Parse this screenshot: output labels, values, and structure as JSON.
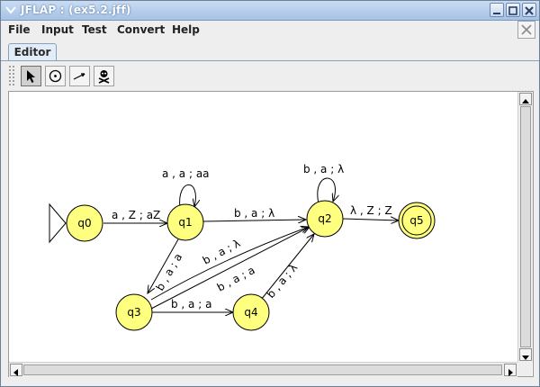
{
  "window": {
    "title": "JFLAP : (ex5.2.jff)"
  },
  "menu": [
    "File",
    "Input",
    "Test",
    "Convert",
    "Help"
  ],
  "tabs": [
    {
      "label": "Editor",
      "active": true
    }
  ],
  "toolbar": {
    "tools": [
      {
        "name": "attribute-editor",
        "icon": "pointer-arrow-icon",
        "selected": true
      },
      {
        "name": "state-creator",
        "icon": "state-circle-icon",
        "selected": false
      },
      {
        "name": "transition-creator",
        "icon": "transition-arrow-icon",
        "selected": false
      },
      {
        "name": "deleter",
        "icon": "skull-crossbones-icon",
        "selected": false
      }
    ]
  },
  "automaton": {
    "states": [
      {
        "id": "q0",
        "label": "q0",
        "initial": true,
        "final": false
      },
      {
        "id": "q1",
        "label": "q1",
        "initial": false,
        "final": false
      },
      {
        "id": "q2",
        "label": "q2",
        "initial": false,
        "final": false
      },
      {
        "id": "q3",
        "label": "q3",
        "initial": false,
        "final": false
      },
      {
        "id": "q4",
        "label": "q4",
        "initial": false,
        "final": false
      },
      {
        "id": "q5",
        "label": "q5",
        "initial": false,
        "final": true
      }
    ],
    "transitions": [
      {
        "from": "q0",
        "to": "q1",
        "label": "a , Z ; aZ"
      },
      {
        "from": "q1",
        "to": "q1",
        "label": "a , a ; aa"
      },
      {
        "from": "q1",
        "to": "q2",
        "label": "b , a ; λ"
      },
      {
        "from": "q2",
        "to": "q2",
        "label": "b , a ; λ"
      },
      {
        "from": "q2",
        "to": "q5",
        "label": "λ , Z ; Z"
      },
      {
        "from": "q1",
        "to": "q3",
        "label": "b , a ; a"
      },
      {
        "from": "q3",
        "to": "q2",
        "label": "b , a ; λ"
      },
      {
        "from": "q3",
        "to": "q2",
        "label": "b , a ; a"
      },
      {
        "from": "q3",
        "to": "q4",
        "label": "b , a ; a"
      },
      {
        "from": "q4",
        "to": "q2",
        "label": "b , a ; λ"
      }
    ]
  },
  "colors": {
    "state_fill": "#ffff7f",
    "state_stroke": "#000000",
    "edge": "#000000",
    "title_text": "#ffffff"
  }
}
